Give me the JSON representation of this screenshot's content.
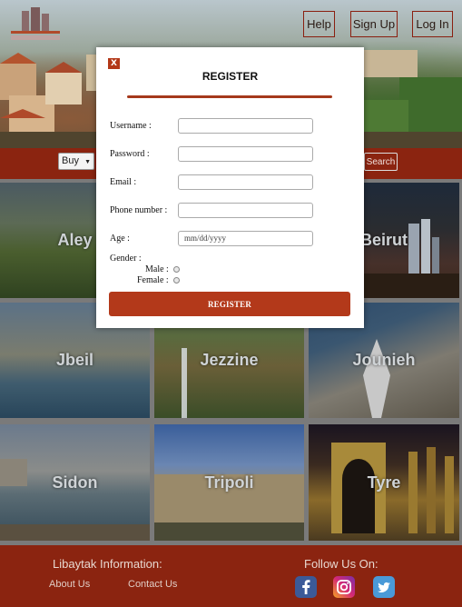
{
  "header": {
    "help_label": "Help",
    "signup_label": "Sign Up",
    "login_label": "Log In"
  },
  "search": {
    "category_value": "Buy",
    "search_label": "Search"
  },
  "cities": [
    {
      "name": "Aley"
    },
    {
      "name": "Beirut"
    },
    {
      "name": "Jbeil"
    },
    {
      "name": "Jezzine"
    },
    {
      "name": "Jounieh"
    },
    {
      "name": "Sidon"
    },
    {
      "name": "Tripoli"
    },
    {
      "name": "Tyre"
    }
  ],
  "footer": {
    "info_title": "Libaytak Information:",
    "about_label": "About Us",
    "contact_label": "Contact Us",
    "follow_title": "Follow Us On:",
    "social": [
      "facebook-icon",
      "instagram-icon",
      "twitter-icon"
    ]
  },
  "modal": {
    "close_label": "X",
    "title": "REGISTER",
    "username_label": "Username :",
    "password_label": "Password :",
    "email_label": "Email :",
    "phone_label": "Phone number :",
    "age_label": "Age :",
    "age_placeholder": "mm/dd/yyyy",
    "gender_label": "Gender :",
    "male_label": "Male :",
    "female_label": "Female :",
    "submit_label": "REGISTER"
  },
  "colors": {
    "brand": "#8b2410",
    "button_red": "#b3391a"
  }
}
